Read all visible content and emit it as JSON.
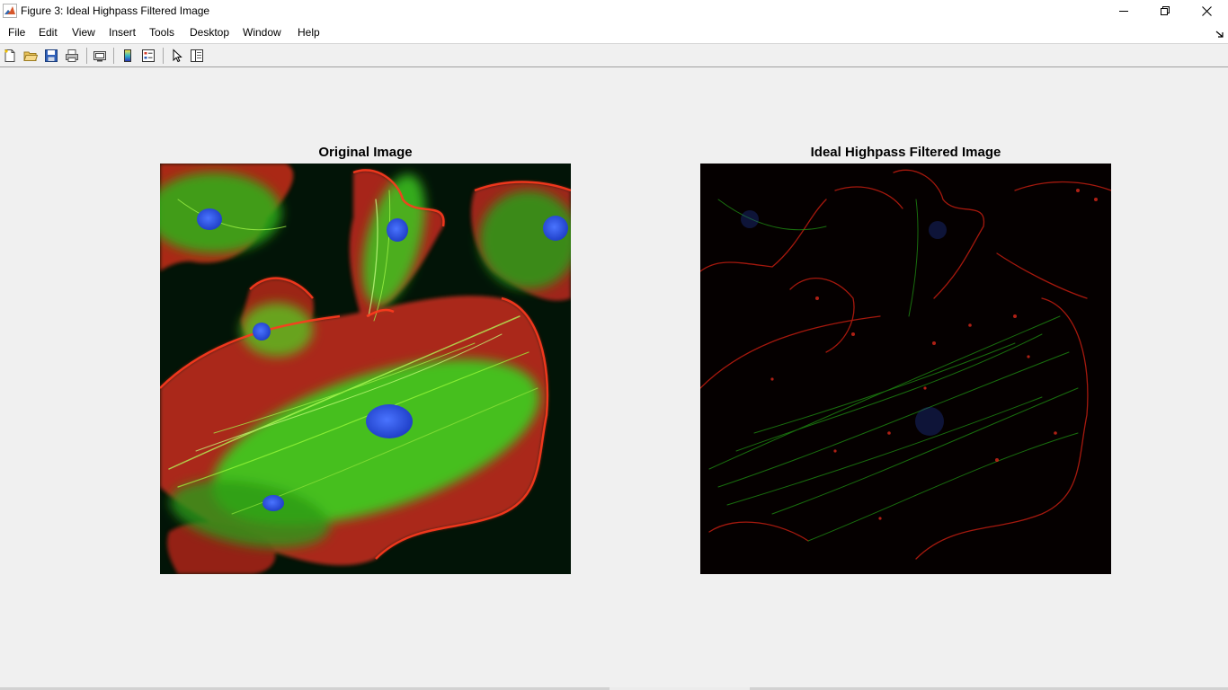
{
  "window": {
    "title": "Figure 3: Ideal Highpass Filtered Image",
    "app_icon": "matlab-icon",
    "controls": [
      "minimize-icon",
      "restore-icon",
      "close-icon"
    ]
  },
  "menubar": {
    "items": [
      {
        "label": "File"
      },
      {
        "label": "Edit"
      },
      {
        "label": "View"
      },
      {
        "label": "Insert"
      },
      {
        "label": "Tools"
      },
      {
        "label": "Desktop"
      },
      {
        "label": "Window"
      },
      {
        "label": "Help"
      }
    ],
    "dock_icon": "dock-arrow-icon"
  },
  "toolbar": {
    "buttons": [
      {
        "icon": "new-figure-icon"
      },
      {
        "icon": "open-file-icon"
      },
      {
        "icon": "save-figure-icon"
      },
      {
        "icon": "print-figure-icon"
      },
      {
        "icon": "link-plot-icon"
      },
      {
        "icon": "insert-colorbar-icon"
      },
      {
        "icon": "insert-legend-icon"
      },
      {
        "icon": "edit-plot-pointer-icon"
      },
      {
        "icon": "property-inspector-icon"
      }
    ]
  },
  "axes": {
    "left": {
      "title": "Original Image"
    },
    "right": {
      "title": "Ideal Highpass Filtered Image"
    }
  },
  "colors": {
    "title_bar": "#ffffff",
    "figure_background": "#f0f0f0",
    "image_background": "#021407",
    "filtered_background": "#050000",
    "actin_red": "#e8281c",
    "tubulin_green": "#3cdc1e",
    "nucleus_blue": "#2a55e6"
  }
}
